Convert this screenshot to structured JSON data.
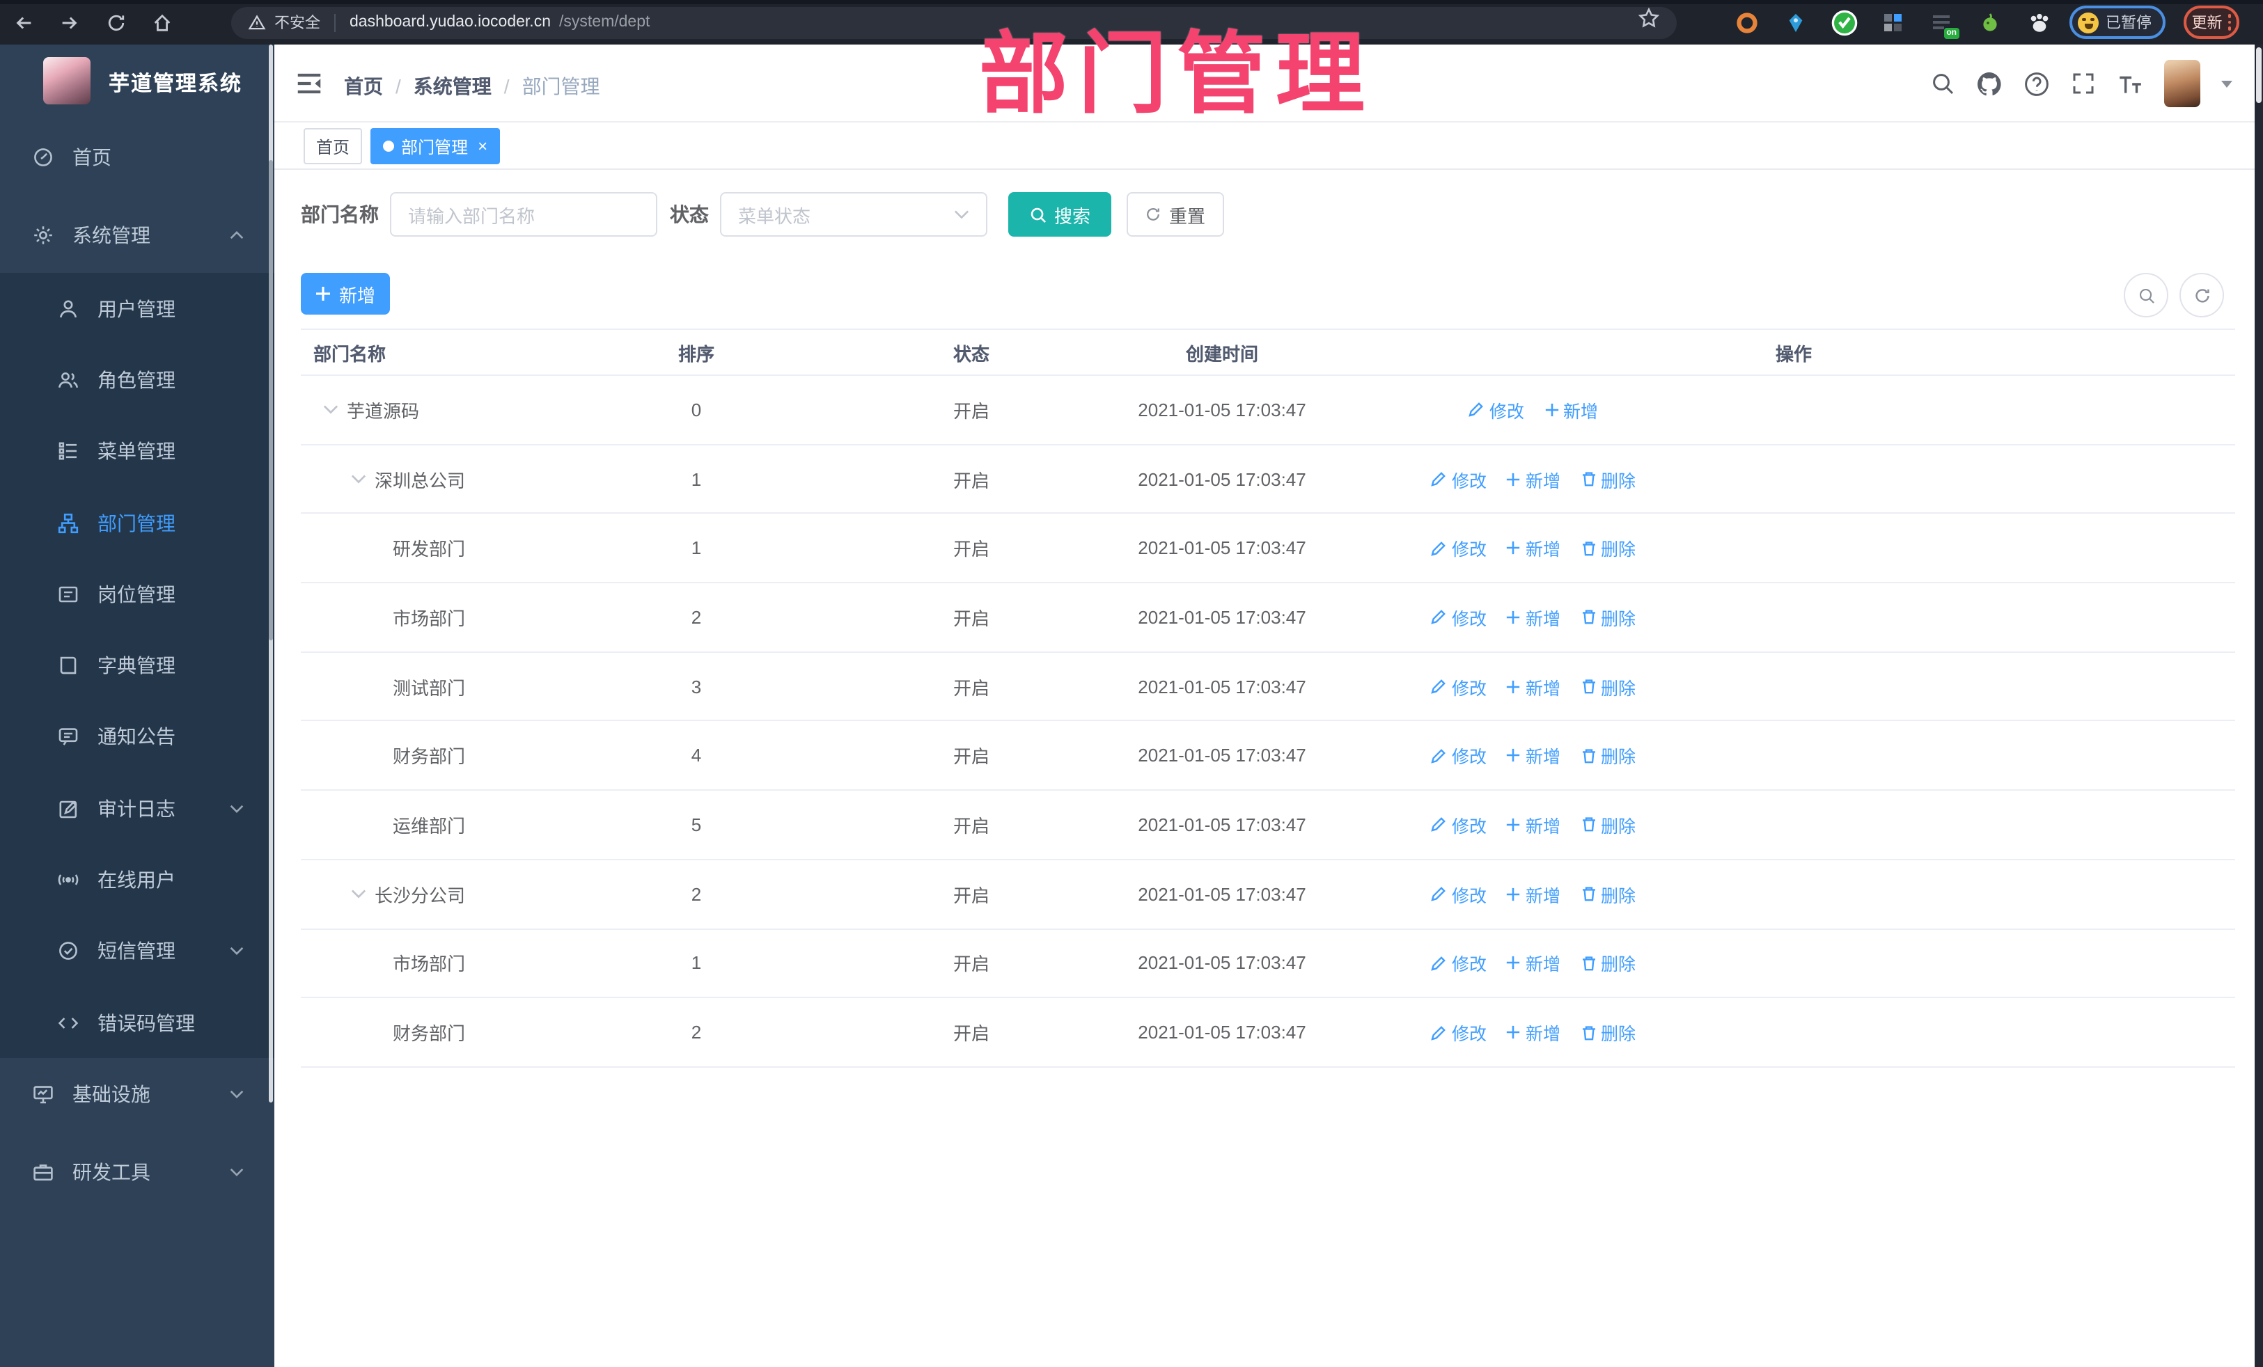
{
  "browser": {
    "security_text": "不安全",
    "url_host": "dashboard.yudao.iocoder.cn",
    "url_path": "/system/dept",
    "paused_badge": "已暂停",
    "update_button": "更新"
  },
  "annotation": {
    "text": "部门管理"
  },
  "sidebar": {
    "app_title": "芋道管理系统",
    "items": [
      {
        "label": "首页"
      },
      {
        "label": "系统管理",
        "expanded": true
      },
      {
        "label": "用户管理"
      },
      {
        "label": "角色管理"
      },
      {
        "label": "菜单管理"
      },
      {
        "label": "部门管理",
        "active": true
      },
      {
        "label": "岗位管理"
      },
      {
        "label": "字典管理"
      },
      {
        "label": "通知公告"
      },
      {
        "label": "审计日志",
        "collapsed": true
      },
      {
        "label": "在线用户"
      },
      {
        "label": "短信管理",
        "collapsed": true
      },
      {
        "label": "错误码管理"
      },
      {
        "label": "基础设施",
        "collapsed": true
      },
      {
        "label": "研发工具",
        "collapsed": true
      }
    ]
  },
  "header": {
    "breadcrumb": [
      "首页",
      "系统管理",
      "部门管理"
    ]
  },
  "tabs": [
    {
      "label": "首页",
      "active": false
    },
    {
      "label": "部门管理",
      "active": true
    }
  ],
  "filter": {
    "name_label": "部门名称",
    "name_placeholder": "请输入部门名称",
    "status_label": "状态",
    "status_placeholder": "菜单状态",
    "search_button": "搜索",
    "reset_button": "重置"
  },
  "toolbar": {
    "add_button": "新增"
  },
  "table": {
    "headers": [
      "部门名称",
      "排序",
      "状态",
      "创建时间",
      "操作"
    ],
    "rows": [
      {
        "name": "芋道源码",
        "level": 0,
        "expandable": true,
        "sort": "0",
        "status": "开启",
        "time": "2021-01-05 17:03:47",
        "ops": [
          "修改",
          "新增"
        ]
      },
      {
        "name": "深圳总公司",
        "level": 1,
        "expandable": true,
        "sort": "1",
        "status": "开启",
        "time": "2021-01-05 17:03:47",
        "ops": [
          "修改",
          "新增",
          "删除"
        ]
      },
      {
        "name": "研发部门",
        "level": 2,
        "expandable": false,
        "sort": "1",
        "status": "开启",
        "time": "2021-01-05 17:03:47",
        "ops": [
          "修改",
          "新增",
          "删除"
        ]
      },
      {
        "name": "市场部门",
        "level": 2,
        "expandable": false,
        "sort": "2",
        "status": "开启",
        "time": "2021-01-05 17:03:47",
        "ops": [
          "修改",
          "新增",
          "删除"
        ]
      },
      {
        "name": "测试部门",
        "level": 2,
        "expandable": false,
        "sort": "3",
        "status": "开启",
        "time": "2021-01-05 17:03:47",
        "ops": [
          "修改",
          "新增",
          "删除"
        ]
      },
      {
        "name": "财务部门",
        "level": 2,
        "expandable": false,
        "sort": "4",
        "status": "开启",
        "time": "2021-01-05 17:03:47",
        "ops": [
          "修改",
          "新增",
          "删除"
        ]
      },
      {
        "name": "运维部门",
        "level": 2,
        "expandable": false,
        "sort": "5",
        "status": "开启",
        "time": "2021-01-05 17:03:47",
        "ops": [
          "修改",
          "新增",
          "删除"
        ]
      },
      {
        "name": "长沙分公司",
        "level": 1,
        "expandable": true,
        "sort": "2",
        "status": "开启",
        "time": "2021-01-05 17:03:47",
        "ops": [
          "修改",
          "新增",
          "删除"
        ]
      },
      {
        "name": "市场部门",
        "level": 2,
        "expandable": false,
        "sort": "1",
        "status": "开启",
        "time": "2021-01-05 17:03:47",
        "ops": [
          "修改",
          "新增",
          "删除"
        ]
      },
      {
        "name": "财务部门",
        "level": 2,
        "expandable": false,
        "sort": "2",
        "status": "开启",
        "time": "2021-01-05 17:03:47",
        "ops": [
          "修改",
          "新增",
          "删除"
        ]
      }
    ]
  },
  "colors": {
    "primary": "#409EFF",
    "teal": "#1BB5AC",
    "annotation_pink": "#F4436E",
    "sidebar": "#2E4156",
    "sidebar_submenu": "#24364A"
  }
}
